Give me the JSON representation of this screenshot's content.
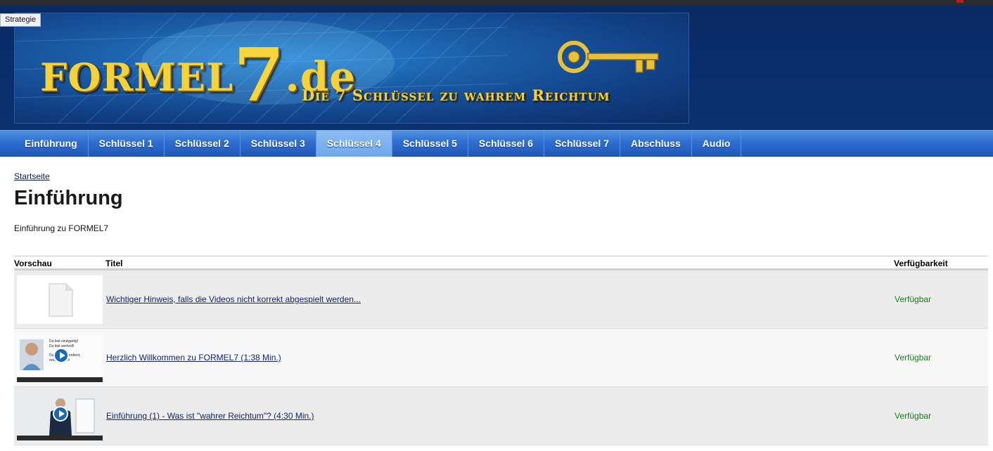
{
  "header": {
    "strategy_tag": "Strategie",
    "brand_main": "FORMEL",
    "brand_seven": "7",
    "brand_tld": ".de",
    "tagline": "Die 7 Schlüssel zu wahrem Reichtum"
  },
  "nav": {
    "items": [
      {
        "label": "Einführung",
        "active": false
      },
      {
        "label": "Schlüssel 1",
        "active": false
      },
      {
        "label": "Schlüssel 2",
        "active": false
      },
      {
        "label": "Schlüssel 3",
        "active": false
      },
      {
        "label": "Schlüssel 4",
        "active": true
      },
      {
        "label": "Schlüssel 5",
        "active": false
      },
      {
        "label": "Schlüssel 6",
        "active": false
      },
      {
        "label": "Schlüssel 7",
        "active": false
      },
      {
        "label": "Abschluss",
        "active": false
      },
      {
        "label": "Audio",
        "active": false
      }
    ]
  },
  "main": {
    "breadcrumb": "Startseite",
    "title": "Einführung",
    "intro": "Einführung zu FORMEL7"
  },
  "table": {
    "headers": {
      "preview": "Vorschau",
      "title": "Titel",
      "availability": "Verfügbarkeit"
    },
    "rows": [
      {
        "thumb": "document-icon",
        "title": "Wichtiger Hinweis, falls die Videos nicht korrekt abgespielt werden...",
        "status": "Verfügbar"
      },
      {
        "thumb": "video-thumbnail-portrait",
        "title": "Herzlich Willkommen zu FORMEL7 (1:38 Min.)",
        "status": "Verfügbar"
      },
      {
        "thumb": "video-thumbnail-presenter",
        "title": "Einführung (1) - Was ist \"wahrer Reichtum\"? (4:30 Min.)",
        "status": "Verfügbar"
      }
    ],
    "thumb_text": {
      "line1": "Du bist einzigartig!",
      "line2": "Du bist wertvoll!",
      "line3": "Du hast es verdient,",
      "line4": "reich zu sein!"
    }
  },
  "colors": {
    "nav_bg": "#2f6fd0",
    "nav_active": "#7fb4f0",
    "header_bg": "#0a2d6b",
    "gold": "#f4d23a",
    "available_green": "#1a7a1a",
    "link": "#142466"
  }
}
